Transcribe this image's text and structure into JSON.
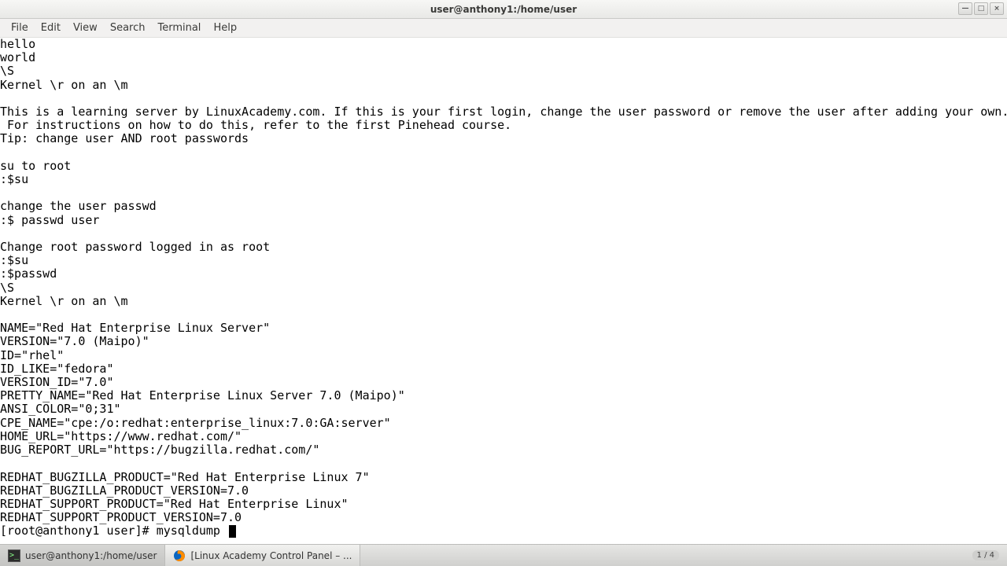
{
  "window": {
    "title": "user@anthony1:/home/user",
    "controls": {
      "min": "—",
      "max": "□",
      "close": "×"
    }
  },
  "menu": {
    "file": "File",
    "edit": "Edit",
    "view": "View",
    "search": "Search",
    "terminal": "Terminal",
    "help": "Help"
  },
  "terminal": {
    "lines": [
      "hello",
      "world",
      "\\S",
      "Kernel \\r on an \\m",
      "",
      "This is a learning server by LinuxAcademy.com. If this is your first login, change the user password or remove the user after adding your own.",
      " For instructions on how to do this, refer to the first Pinehead course.",
      "Tip: change user AND root passwords",
      "",
      "su to root",
      ":$su",
      "",
      "change the user passwd",
      ":$ passwd user",
      "",
      "Change root password logged in as root",
      ":$su",
      ":$passwd",
      "\\S",
      "Kernel \\r on an \\m",
      "",
      "NAME=\"Red Hat Enterprise Linux Server\"",
      "VERSION=\"7.0 (Maipo)\"",
      "ID=\"rhel\"",
      "ID_LIKE=\"fedora\"",
      "VERSION_ID=\"7.0\"",
      "PRETTY_NAME=\"Red Hat Enterprise Linux Server 7.0 (Maipo)\"",
      "ANSI_COLOR=\"0;31\"",
      "CPE_NAME=\"cpe:/o:redhat:enterprise_linux:7.0:GA:server\"",
      "HOME_URL=\"https://www.redhat.com/\"",
      "BUG_REPORT_URL=\"https://bugzilla.redhat.com/\"",
      "",
      "REDHAT_BUGZILLA_PRODUCT=\"Red Hat Enterprise Linux 7\"",
      "REDHAT_BUGZILLA_PRODUCT_VERSION=7.0",
      "REDHAT_SUPPORT_PRODUCT=\"Red Hat Enterprise Linux\"",
      "REDHAT_SUPPORT_PRODUCT_VERSION=7.0"
    ],
    "prompt": "[root@anthony1 user]# ",
    "command": "mysqldump "
  },
  "taskbar": {
    "terminal_label": "user@anthony1:/home/user",
    "firefox_label": "[Linux Academy Control Panel – ...",
    "slide": "1 / 4"
  }
}
